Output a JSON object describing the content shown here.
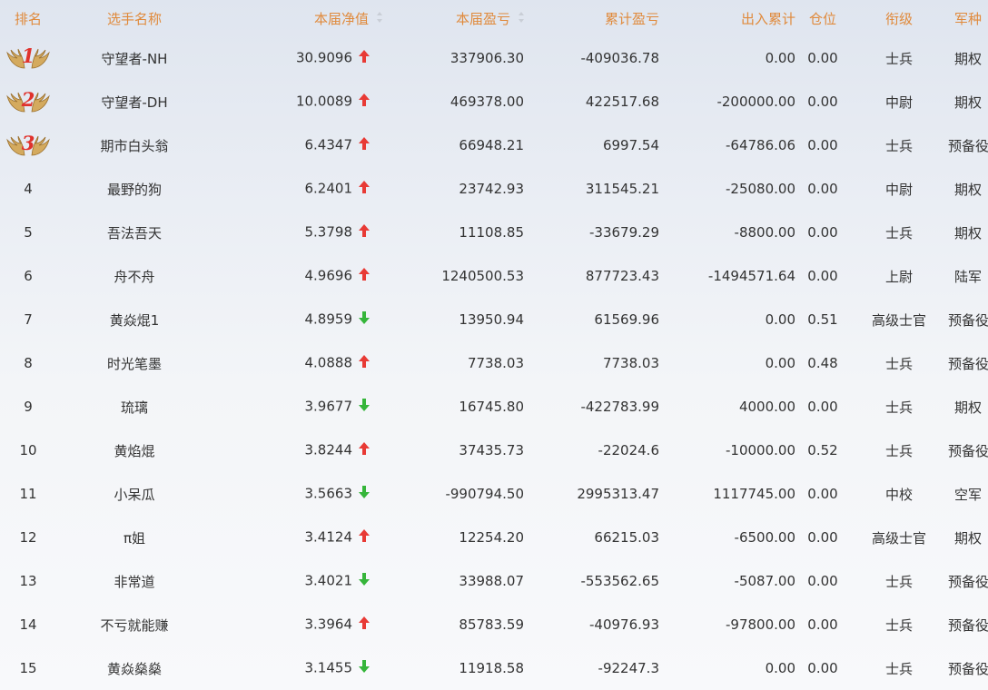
{
  "headers": {
    "rank": "排名",
    "name": "选手名称",
    "nav": "本届净值",
    "pnl": "本届盈亏",
    "cum_pnl": "累计盈亏",
    "flow": "出入累计",
    "position": "仓位",
    "title": "衔级",
    "branch": "军种"
  },
  "colors": {
    "header_text": "#e08a3c",
    "up": "#e83a35",
    "down": "#35b53a",
    "medal_number": "#e0322c",
    "text": "#333333"
  },
  "rows": [
    {
      "rank": "1",
      "name": "守望者-NH",
      "nav": "30.9096",
      "trend": "up",
      "pnl": "337906.30",
      "cum_pnl": "-409036.78",
      "flow": "0.00",
      "position": "0.00",
      "title": "士兵",
      "branch": "期权"
    },
    {
      "rank": "2",
      "name": "守望者-DH",
      "nav": "10.0089",
      "trend": "up",
      "pnl": "469378.00",
      "cum_pnl": "422517.68",
      "flow": "-200000.00",
      "position": "0.00",
      "title": "中尉",
      "branch": "期权"
    },
    {
      "rank": "3",
      "name": "期市白头翁",
      "nav": "6.4347",
      "trend": "up",
      "pnl": "66948.21",
      "cum_pnl": "6997.54",
      "flow": "-64786.06",
      "position": "0.00",
      "title": "士兵",
      "branch": "预备役"
    },
    {
      "rank": "4",
      "name": "最野的狗",
      "nav": "6.2401",
      "trend": "up",
      "pnl": "23742.93",
      "cum_pnl": "311545.21",
      "flow": "-25080.00",
      "position": "0.00",
      "title": "中尉",
      "branch": "期权"
    },
    {
      "rank": "5",
      "name": "吾法吾天",
      "nav": "5.3798",
      "trend": "up",
      "pnl": "11108.85",
      "cum_pnl": "-33679.29",
      "flow": "-8800.00",
      "position": "0.00",
      "title": "士兵",
      "branch": "期权"
    },
    {
      "rank": "6",
      "name": "舟不舟",
      "nav": "4.9696",
      "trend": "up",
      "pnl": "1240500.53",
      "cum_pnl": "877723.43",
      "flow": "-1494571.64",
      "position": "0.00",
      "title": "上尉",
      "branch": "陆军"
    },
    {
      "rank": "7",
      "name": "黄焱焜1",
      "nav": "4.8959",
      "trend": "down",
      "pnl": "13950.94",
      "cum_pnl": "61569.96",
      "flow": "0.00",
      "position": "0.51",
      "title": "高级士官",
      "branch": "预备役"
    },
    {
      "rank": "8",
      "name": "时光笔墨",
      "nav": "4.0888",
      "trend": "up",
      "pnl": "7738.03",
      "cum_pnl": "7738.03",
      "flow": "0.00",
      "position": "0.48",
      "title": "士兵",
      "branch": "预备役"
    },
    {
      "rank": "9",
      "name": "琉璃",
      "nav": "3.9677",
      "trend": "down",
      "pnl": "16745.80",
      "cum_pnl": "-422783.99",
      "flow": "4000.00",
      "position": "0.00",
      "title": "士兵",
      "branch": "期权"
    },
    {
      "rank": "10",
      "name": "黄焰焜",
      "nav": "3.8244",
      "trend": "up",
      "pnl": "37435.73",
      "cum_pnl": "-22024.6",
      "flow": "-10000.00",
      "position": "0.52",
      "title": "士兵",
      "branch": "预备役"
    },
    {
      "rank": "11",
      "name": "小呆瓜",
      "nav": "3.5663",
      "trend": "down",
      "pnl": "-990794.50",
      "cum_pnl": "2995313.47",
      "flow": "1117745.00",
      "position": "0.00",
      "title": "中校",
      "branch": "空军"
    },
    {
      "rank": "12",
      "name": "π姐",
      "nav": "3.4124",
      "trend": "up",
      "pnl": "12254.20",
      "cum_pnl": "66215.03",
      "flow": "-6500.00",
      "position": "0.00",
      "title": "高级士官",
      "branch": "期权"
    },
    {
      "rank": "13",
      "name": "非常道",
      "nav": "3.4021",
      "trend": "down",
      "pnl": "33988.07",
      "cum_pnl": "-553562.65",
      "flow": "-5087.00",
      "position": "0.00",
      "title": "士兵",
      "branch": "预备役"
    },
    {
      "rank": "14",
      "name": "不亏就能赚",
      "nav": "3.3964",
      "trend": "up",
      "pnl": "85783.59",
      "cum_pnl": "-40976.93",
      "flow": "-97800.00",
      "position": "0.00",
      "title": "士兵",
      "branch": "预备役"
    },
    {
      "rank": "15",
      "name": "黄焱燊燊",
      "nav": "3.1455",
      "trend": "down",
      "pnl": "11918.58",
      "cum_pnl": "-92247.3",
      "flow": "0.00",
      "position": "0.00",
      "title": "士兵",
      "branch": "预备役"
    }
  ]
}
